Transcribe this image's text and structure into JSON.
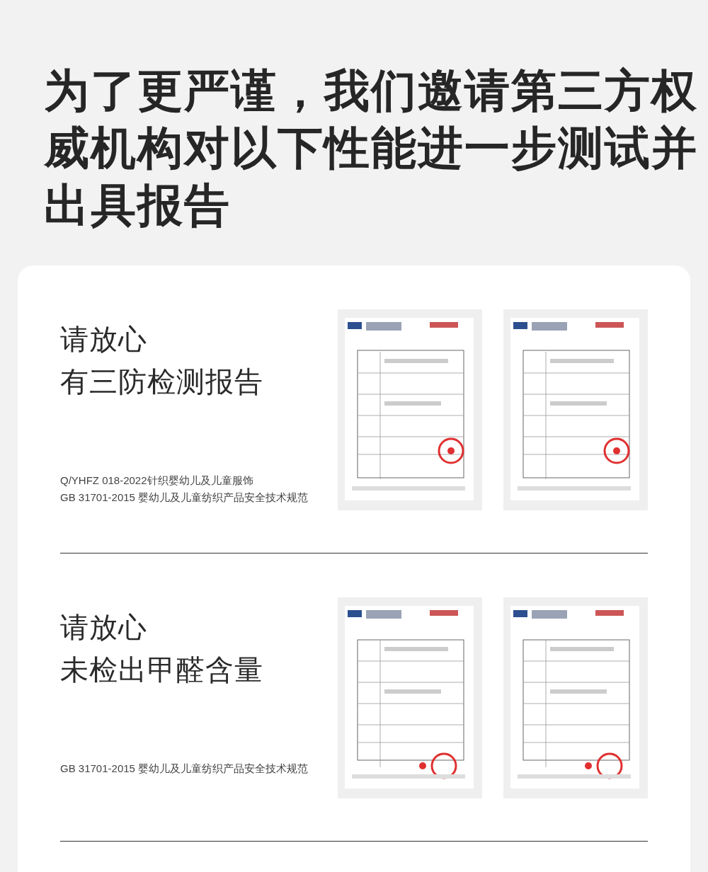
{
  "headline_lines": [
    "为了更严谨，我们邀请第三方权",
    "威机构对以下性能进一步测试并",
    "出具报告"
  ],
  "sections": [
    {
      "heading_lines": [
        "请放心",
        "有三防检测报告"
      ],
      "standards": [
        "Q/YHFZ 018-2022针织婴幼儿及儿童服饰",
        "GB 31701-2015 婴幼儿及儿童纺织产品安全技术规范"
      ],
      "reports": [
        {
          "kind": "picture"
        },
        {
          "kind": "picture"
        }
      ]
    },
    {
      "heading_lines": [
        "请放心",
        "未检出甲醛含量"
      ],
      "standards": [
        "GB 31701-2015 婴幼儿及儿童纺织产品安全技术规范"
      ],
      "reports": [
        {
          "kind": "picture"
        },
        {
          "kind": "picture"
        }
      ]
    }
  ]
}
